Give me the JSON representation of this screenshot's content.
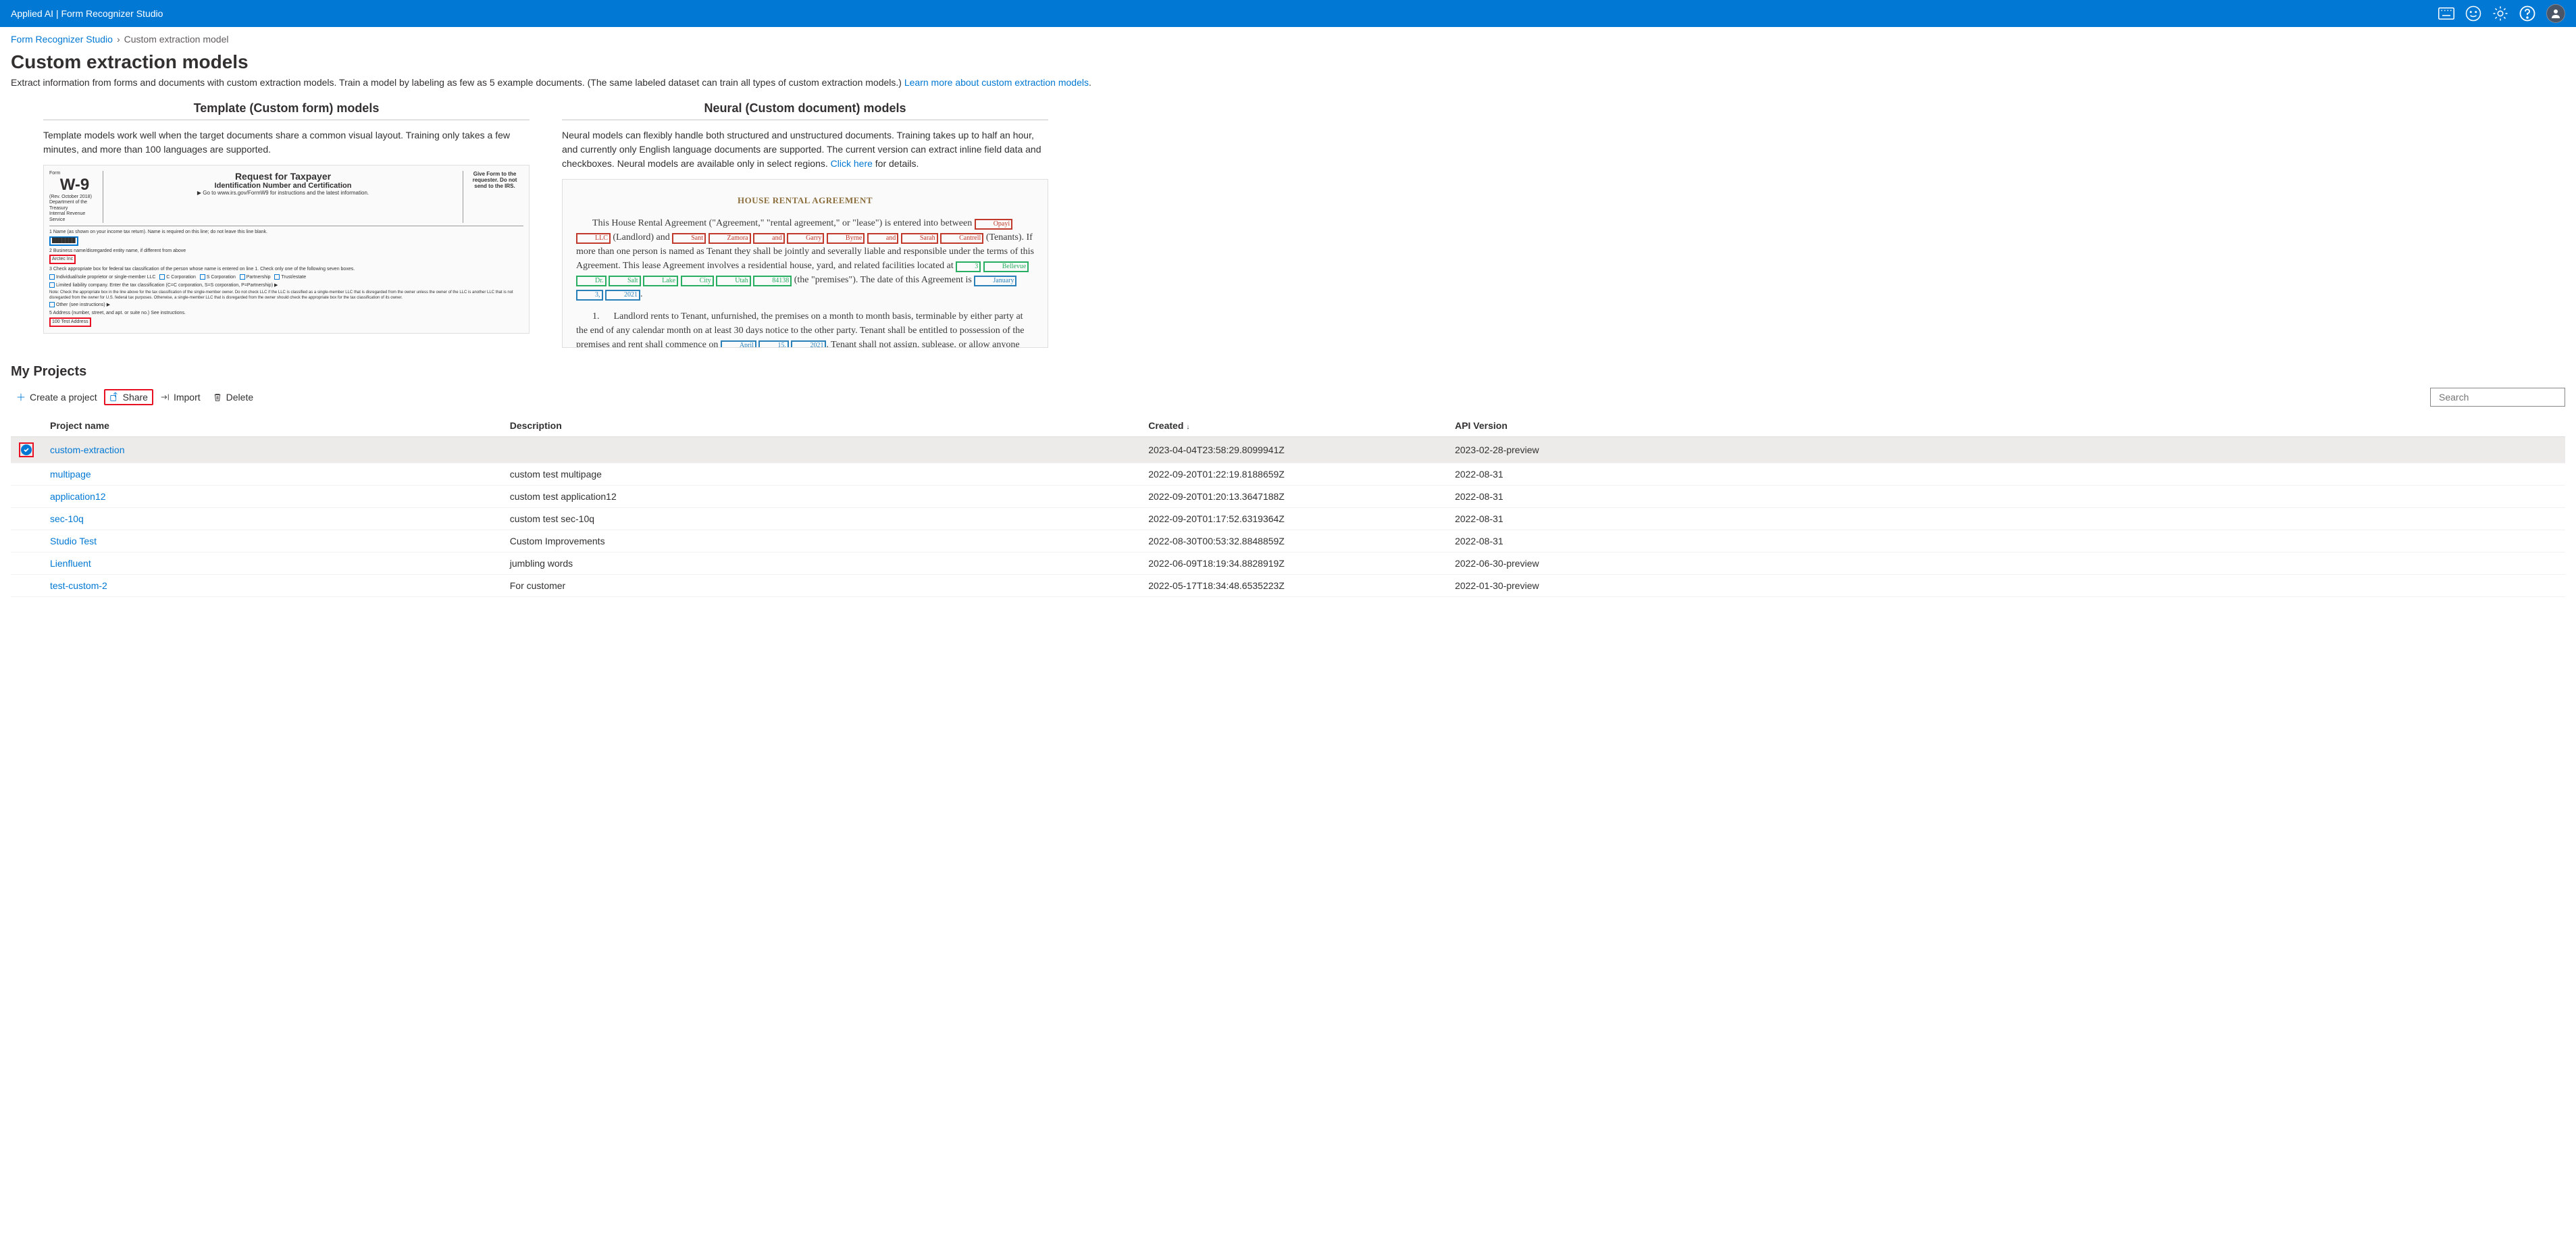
{
  "header": {
    "title": "Applied AI | Form Recognizer Studio"
  },
  "breadcrumb": {
    "home": "Form Recognizer Studio",
    "current": "Custom extraction model"
  },
  "page": {
    "title": "Custom extraction models",
    "description": "Extract information from forms and documents with custom extraction models. Train a model by labeling as few as 5 example documents. (The same labeled dataset can train all types of custom extraction models.) ",
    "learn_more": "Learn more about custom extraction models"
  },
  "models": {
    "template": {
      "title": "Template (Custom form) models",
      "desc": "Template models work well when the target documents share a common visual layout. Training only takes a few minutes, and more than 100 languages are supported."
    },
    "neural": {
      "title": "Neural (Custom document) models",
      "desc_pre": "Neural models can flexibly handle both structured and unstructured documents. Training takes up to half an hour, and currently only English language documents are supported. The current version can extract inline field data and checkboxes. Neural models are available only in select regions. ",
      "click_here": "Click here",
      "desc_post": " for details."
    }
  },
  "section": {
    "title": "My Projects"
  },
  "toolbar": {
    "create": "Create a project",
    "share": "Share",
    "import": "Import",
    "delete": "Delete"
  },
  "search": {
    "placeholder": "Search"
  },
  "table": {
    "headers": {
      "name": "Project name",
      "description": "Description",
      "created": "Created",
      "api": "API Version"
    },
    "rows": [
      {
        "name": "custom-extraction",
        "description": "",
        "created": "2023-04-04T23:58:29.8099941Z",
        "api": "2023-02-28-preview",
        "selected": true
      },
      {
        "name": "multipage",
        "description": "custom test multipage",
        "created": "2022-09-20T01:22:19.8188659Z",
        "api": "2022-08-31"
      },
      {
        "name": "application12",
        "description": "custom test application12",
        "created": "2022-09-20T01:20:13.3647188Z",
        "api": "2022-08-31"
      },
      {
        "name": "sec-10q",
        "description": "custom test sec-10q",
        "created": "2022-09-20T01:17:52.6319364Z",
        "api": "2022-08-31"
      },
      {
        "name": "Studio Test",
        "description": "Custom Improvements",
        "created": "2022-08-30T00:53:32.8848859Z",
        "api": "2022-08-31"
      },
      {
        "name": "Lienfluent",
        "description": "jumbling words",
        "created": "2022-06-09T18:19:34.8828919Z",
        "api": "2022-06-30-preview"
      },
      {
        "name": "test-custom-2",
        "description": "For customer",
        "created": "2022-05-17T18:34:48.6535223Z",
        "api": "2022-01-30-preview"
      }
    ]
  }
}
